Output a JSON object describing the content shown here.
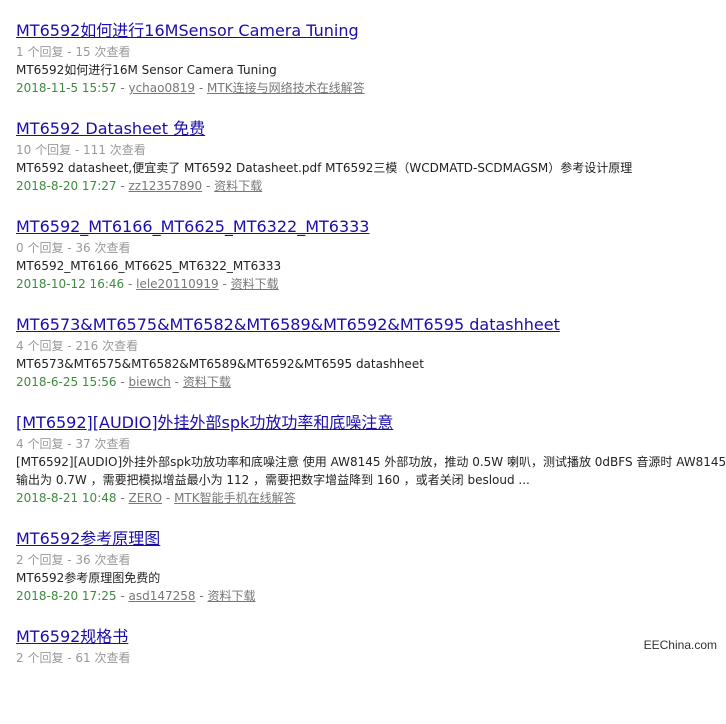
{
  "results": [
    {
      "title": "MT6592如何进行16MSensor Camera Tuning",
      "stats": "1 个回复 - 15 次查看",
      "snippet": "MT6592如何进行16M Sensor Camera Tuning",
      "date": "2018-11-5 15:57",
      "user": "ychao0819",
      "forum": "MTK连接与网络技术在线解答"
    },
    {
      "title": "MT6592 Datasheet 免费",
      "stats": "10 个回复 - 111 次查看",
      "snippet": "MT6592 datasheet,便宜卖了 MT6592 Datasheet.pdf MT6592三模（WCDMATD-SCDMAGSM）参考设计原理",
      "date": "2018-8-20 17:27",
      "user": "zz12357890",
      "forum": "资料下载"
    },
    {
      "title": "MT6592_MT6166_MT6625_MT6322_MT6333",
      "stats": "0 个回复 - 36 次查看",
      "snippet": "MT6592_MT6166_MT6625_MT6322_MT6333",
      "date": "2018-10-12 16:46",
      "user": "lele20110919",
      "forum": "资料下载"
    },
    {
      "title": "MT6573&MT6575&MT6582&MT6589&MT6592&MT6595 datashheet",
      "stats": "4 个回复 - 216 次查看",
      "snippet": "MT6573&MT6575&MT6582&MT6589&MT6592&MT6595 datashheet",
      "date": "2018-6-25 15:56",
      "user": "biewch",
      "forum": "资料下载"
    },
    {
      "title": "[MT6592][AUDIO]外挂外部spk功放功率和底噪注意",
      "stats": "4 个回复 - 37 次查看",
      "snippet": "[MT6592][AUDIO]外挂外部spk功放功率和底噪注意 使用 AW8145 外部功放，推动 0.5W 喇叭，测试播放 0dBFS 音源时 AW8145 输出为 0.7W ，需要把模拟增益最小为 112 ，需要把数字增益降到 160 ，或者关闭 besloud ...",
      "date": "2018-8-21 10:48",
      "user": "ZERO",
      "forum": "MTK智能手机在线解答"
    },
    {
      "title": "MT6592参考原理图",
      "stats": "2 个回复 - 36 次查看",
      "snippet": "MT6592参考原理图免费的",
      "date": "2018-8-20 17:25",
      "user": "asd147258",
      "forum": "资料下载"
    },
    {
      "title": "MT6592规格书",
      "stats": "2 个回复 - 61 次查看",
      "snippet": "",
      "date": "",
      "user": "",
      "forum": ""
    }
  ],
  "watermark": "EEChina.com"
}
